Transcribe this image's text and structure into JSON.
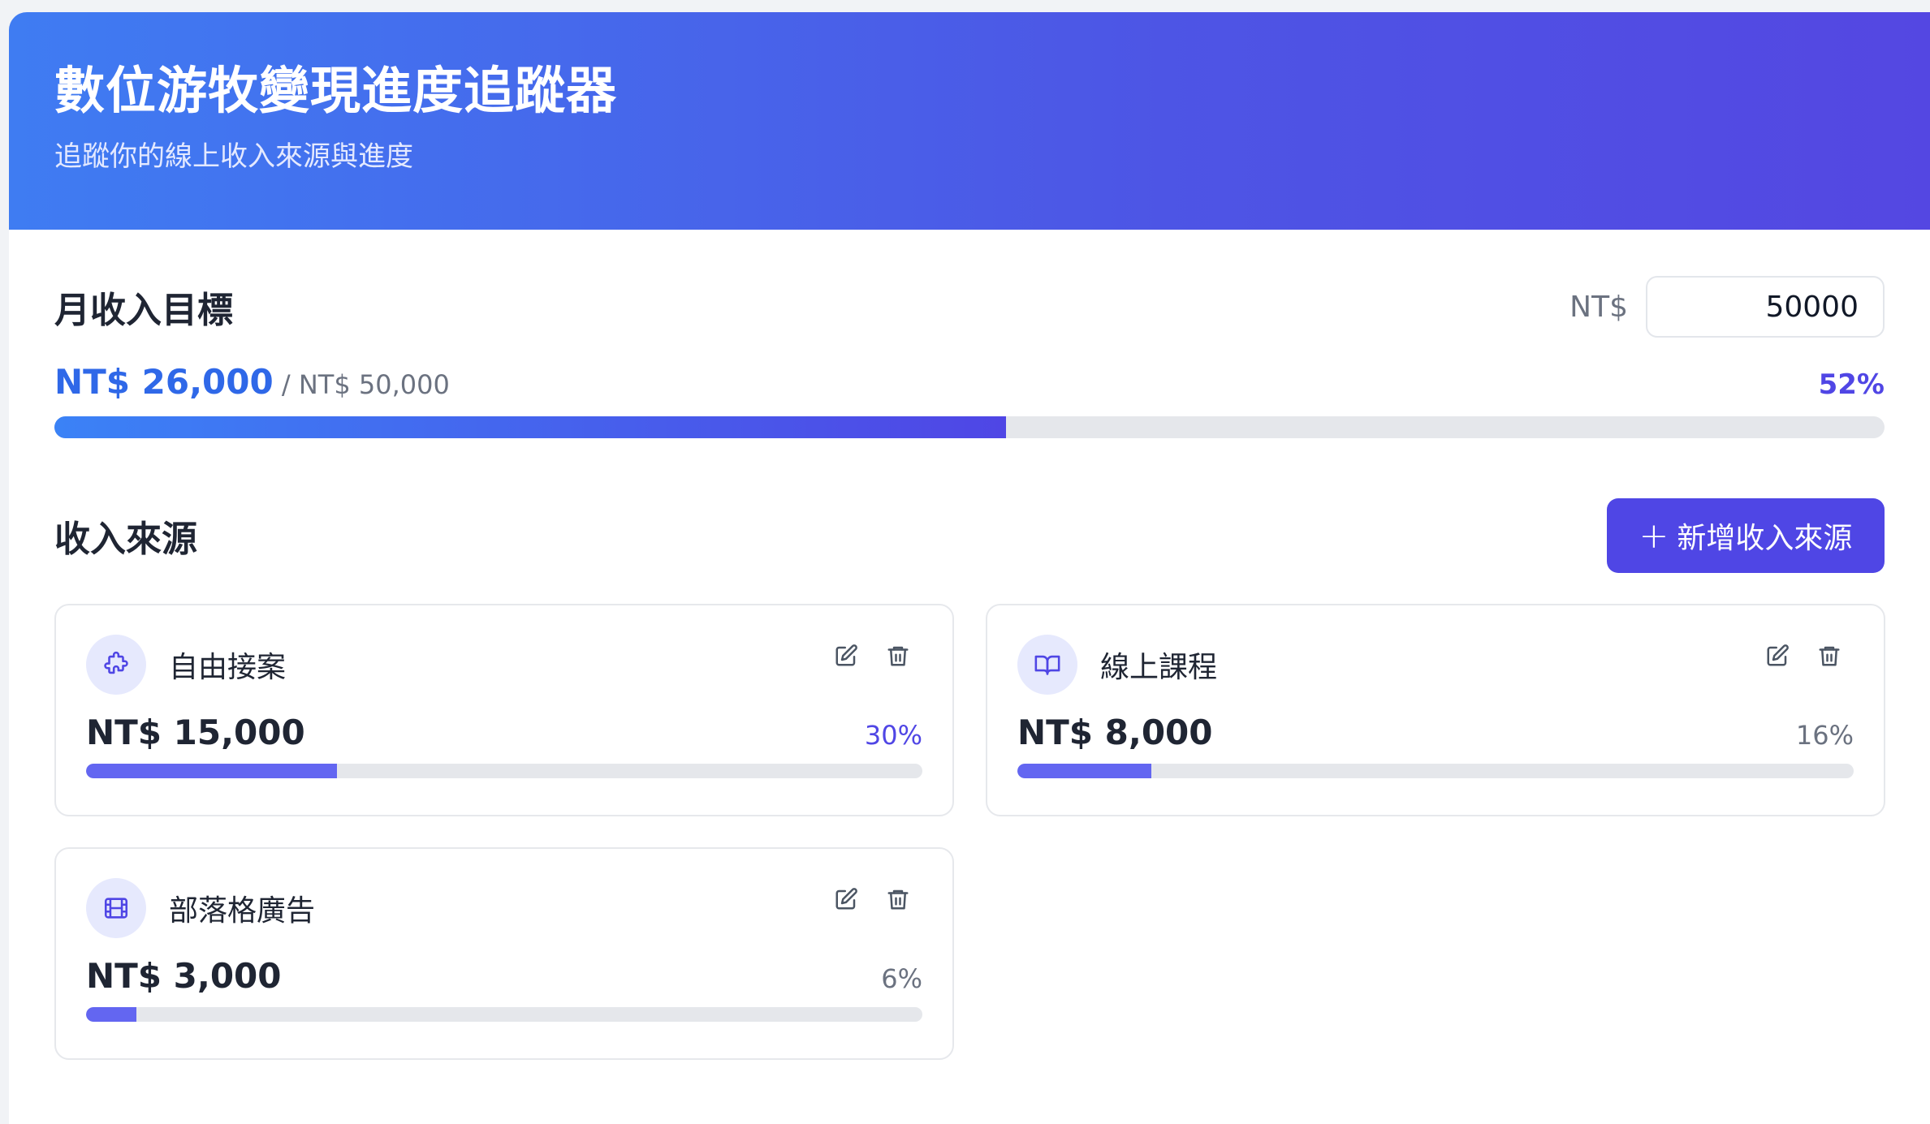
{
  "header": {
    "title": "數位游牧變現進度追蹤器",
    "subtitle": "追蹤你的線上收入來源與進度"
  },
  "goal": {
    "section_title": "月收入目標",
    "currency_label": "NT$",
    "input_value": "50000",
    "current_amount": "NT$ 26,000",
    "target_amount": " / NT$ 50,000",
    "percent": "52%",
    "progress_fraction": 0.52
  },
  "sources": {
    "section_title": "收入來源",
    "add_button_label": "新增收入來源",
    "items": [
      {
        "name": "自由接案",
        "amount": "NT$ 15,000",
        "percent": "30%",
        "fraction": 0.3,
        "percent_color": "#5046e5",
        "icon": "puzzle-icon"
      },
      {
        "name": "線上課程",
        "amount": "NT$ 8,000",
        "percent": "16%",
        "fraction": 0.16,
        "percent_color": "#6b7280",
        "icon": "book-icon"
      },
      {
        "name": "部落格廣告",
        "amount": "NT$ 3,000",
        "percent": "6%",
        "fraction": 0.06,
        "percent_color": "#6b7280",
        "icon": "film-icon"
      }
    ]
  },
  "colors": {
    "accent": "#4f46e5",
    "primary_blue": "#2f68e8",
    "bar_track": "#e5e7eb"
  }
}
